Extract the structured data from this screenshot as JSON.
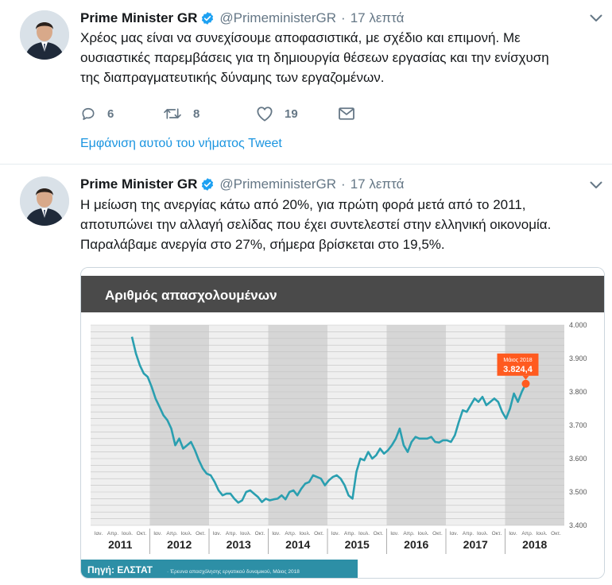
{
  "colors": {
    "accent": "#1b95e0",
    "verified": "#1da1f2",
    "muted": "#657786",
    "chart_line": "#2a9fb0",
    "chart_marker": "#ff5a1f",
    "banner": "#4a4a4a",
    "source_bar": "#2d8fa6"
  },
  "icons": {
    "caret": "chevron-down-icon",
    "reply": "reply-icon",
    "retweet": "retweet-icon",
    "like": "heart-icon",
    "dm": "envelope-icon",
    "verified": "verified-badge-icon"
  },
  "tweets": [
    {
      "name": "Prime Minister GR",
      "handle": "@PrimeministerGR",
      "dot": "·",
      "time": "17 λεπτά",
      "lines": [
        "Χρέος μας είναι να συνεχίσουμε αποφασιστικά, με σχέδιο και επιμονή. Με",
        "ουσιαστικές παρεμβάσεις για τη δημιουργία θέσεων εργασίας και την ενίσχυση",
        "της διαπραγματευτικής δύναμης των εργαζομένων."
      ],
      "replies": "6",
      "retweets": "8",
      "likes": "19",
      "thread_link": "Εμφάνιση αυτού του νήματος Tweet"
    },
    {
      "name": "Prime Minister GR",
      "handle": "@PrimeministerGR",
      "dot": "·",
      "time": "17 λεπτά",
      "lines": [
        "Η μείωση της ανεργίας κάτω από 20%, για πρώτη φορά μετά από το 2011,",
        "αποτυπώνει την αλλαγή σελίδας που έχει συντελεστεί στην ελληνική οικονομία.",
        "Παραλάβαμε ανεργία στο 27%, σήμερα βρίσκεται στο 19,5%."
      ]
    }
  ],
  "chart_data": {
    "type": "line",
    "title": "Αριθμός απασχολουμένων",
    "ylim": [
      3400,
      4000
    ],
    "yticks": [
      "4.000",
      "3.900",
      "3.800",
      "3.700",
      "3.600",
      "3.500",
      "3.400"
    ],
    "months": [
      "Ιαν.",
      "Απρ.",
      "Ιουλ.",
      "Οκτ."
    ],
    "years": [
      "2011",
      "2012",
      "2013",
      "2014",
      "2015",
      "2016",
      "2017",
      "2018"
    ],
    "series": [
      {
        "values": [
          3965,
          3915,
          3880,
          3855,
          3845,
          3815,
          3780,
          3755,
          3730,
          3715,
          3690,
          3640,
          3660,
          3630,
          3640,
          3650,
          3625,
          3595,
          3570,
          3555,
          3550,
          3530,
          3505,
          3490,
          3495,
          3495,
          3480,
          3468,
          3475,
          3500,
          3505,
          3495,
          3485,
          3470,
          3480,
          3475,
          3478,
          3480,
          3490,
          3478,
          3500,
          3505,
          3490,
          3510,
          3525,
          3530,
          3550,
          3545,
          3540,
          3520,
          3535,
          3545,
          3550,
          3540,
          3520,
          3490,
          3480,
          3560,
          3600,
          3595,
          3620,
          3600,
          3610,
          3630,
          3615,
          3625,
          3640,
          3660,
          3690,
          3640,
          3620,
          3650,
          3665,
          3660,
          3660,
          3660,
          3665,
          3650,
          3648,
          3655,
          3655,
          3650,
          3670,
          3710,
          3745,
          3740,
          3760,
          3780,
          3770,
          3785,
          3760,
          3770,
          3780,
          3770,
          3740,
          3720,
          3750,
          3795,
          3770,
          3800,
          3824.4
        ]
      }
    ],
    "annotation": {
      "label": "Μάιος 2018",
      "value": "3.824,4"
    },
    "source": {
      "label": "Πηγή: ΕΛΣΤΑΤ",
      "detail": "· Έρευνα απασχόλησης εργατικού δυναμικού, Μάιος 2018"
    },
    "grid": true
  }
}
